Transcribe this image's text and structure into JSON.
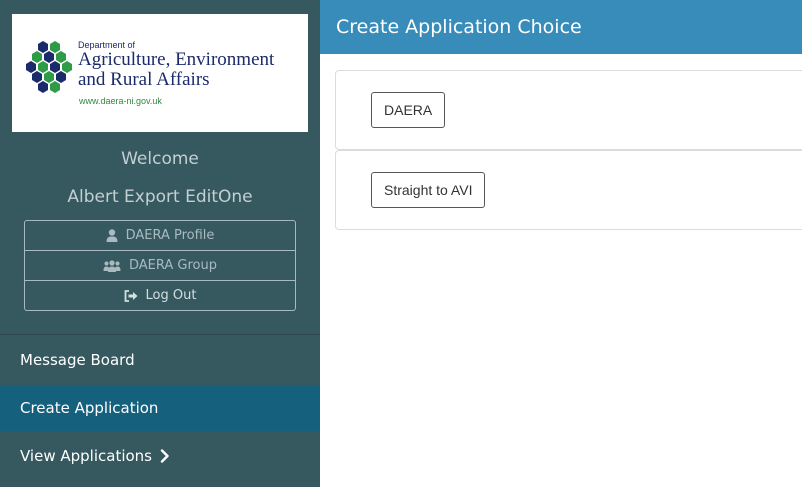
{
  "brand": {
    "dept_small": "Department of",
    "line1": "Agriculture, Environment",
    "line2": "and Rural Affairs",
    "url": "www.daera-ni.gov.uk",
    "logo_colors": {
      "navy": "#1b2a6b",
      "green": "#2e9b46"
    }
  },
  "sidebar": {
    "welcome": "Welcome",
    "user_name": "Albert Export EditOne",
    "user_menu": [
      {
        "label": "DAERA Profile",
        "icon": "user-icon"
      },
      {
        "label": "DAERA Group",
        "icon": "users-icon"
      },
      {
        "label": "Log Out",
        "icon": "sign-out-icon"
      }
    ],
    "nav": [
      {
        "label": "Message Board",
        "active": false
      },
      {
        "label": "Create Application",
        "active": true
      },
      {
        "label": "View Applications",
        "active": false,
        "icon": "chevron-right-icon"
      }
    ]
  },
  "header": {
    "title": "Create Application Choice"
  },
  "choices": [
    {
      "label": "DAERA"
    },
    {
      "label": "Straight to AVI"
    }
  ],
  "colors": {
    "sidebar_bg": "#36585f",
    "nav_active": "#14607d",
    "header_bg": "#388cba"
  }
}
